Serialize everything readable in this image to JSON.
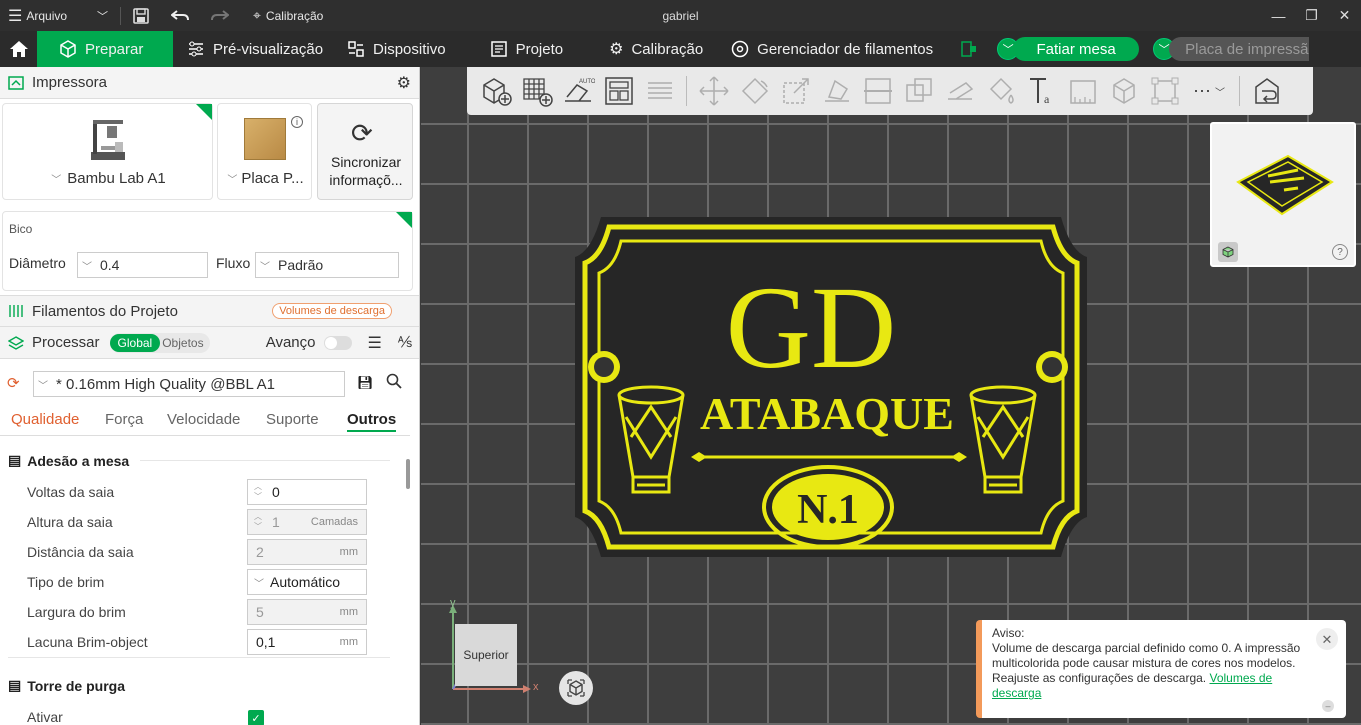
{
  "titlebar": {
    "menu_label": "Arquivo",
    "calib_label": "Calibração",
    "window_title": "gabriel"
  },
  "menubar": {
    "tabs": [
      {
        "label": "Preparar"
      },
      {
        "label": "Pré-visualização"
      },
      {
        "label": "Dispositivo"
      },
      {
        "label": "Projeto"
      },
      {
        "label": "Calibração"
      },
      {
        "label": "Gerenciador de filamentos"
      }
    ],
    "slice_button": "Fatiar mesa",
    "print_button": "Placa de impressão"
  },
  "printer": {
    "section_title": "Impressora",
    "printer_name": "Bambu Lab A1",
    "plate_name": "Placa P...",
    "sync_line1": "Sincronizar",
    "sync_line2": "informaçõ...",
    "nozzle_label": "Bico",
    "diameter_label": "Diâmetro",
    "diameter_value": "0.4",
    "flow_label": "Fluxo",
    "flow_value": "Padrão"
  },
  "filaments": {
    "section_title": "Filamentos do Projeto",
    "badge": "Volumes de descarga"
  },
  "process": {
    "section_title": "Processar",
    "toggle_global": "Global",
    "toggle_objects": "Objetos",
    "advanced_label": "Avanço",
    "profile": "* 0.16mm High Quality @BBL A1",
    "tabs": [
      "Qualidade",
      "Força",
      "Velocidade",
      "Suporte",
      "Outros"
    ],
    "group1_title": "Adesão a mesa",
    "rows": [
      {
        "label": "Voltas da saia",
        "value": "0",
        "unit": ""
      },
      {
        "label": "Altura da saia",
        "value": "1",
        "unit": "Camadas"
      },
      {
        "label": "Distância da saia",
        "value": "2",
        "unit": "mm"
      },
      {
        "label": "Tipo de brim",
        "value": "Automático",
        "unit": ""
      },
      {
        "label": "Largura do brim",
        "value": "5",
        "unit": "mm"
      },
      {
        "label": "Lacuna Brim-object",
        "value": "0,1",
        "unit": "mm"
      }
    ],
    "group2_title": "Torre de purga",
    "enable_label": "Ativar"
  },
  "viewport": {
    "view_label": "Superior",
    "axis_x": "x",
    "axis_y": "y",
    "model_text_top": "GD",
    "model_text_mid": "ATABAQUE",
    "model_text_bottom": "N.1"
  },
  "warning": {
    "title": "Aviso:",
    "body": "Volume de descarga parcial definido como 0. A impressão multicolorida pode causar mistura de cores nos modelos. Reajuste as configurações de descarga.",
    "link": "Volumes de descarga"
  },
  "colors": {
    "accent": "#00a94f",
    "model_yellow": "#e8e812",
    "model_dark": "#2a2a2a"
  }
}
